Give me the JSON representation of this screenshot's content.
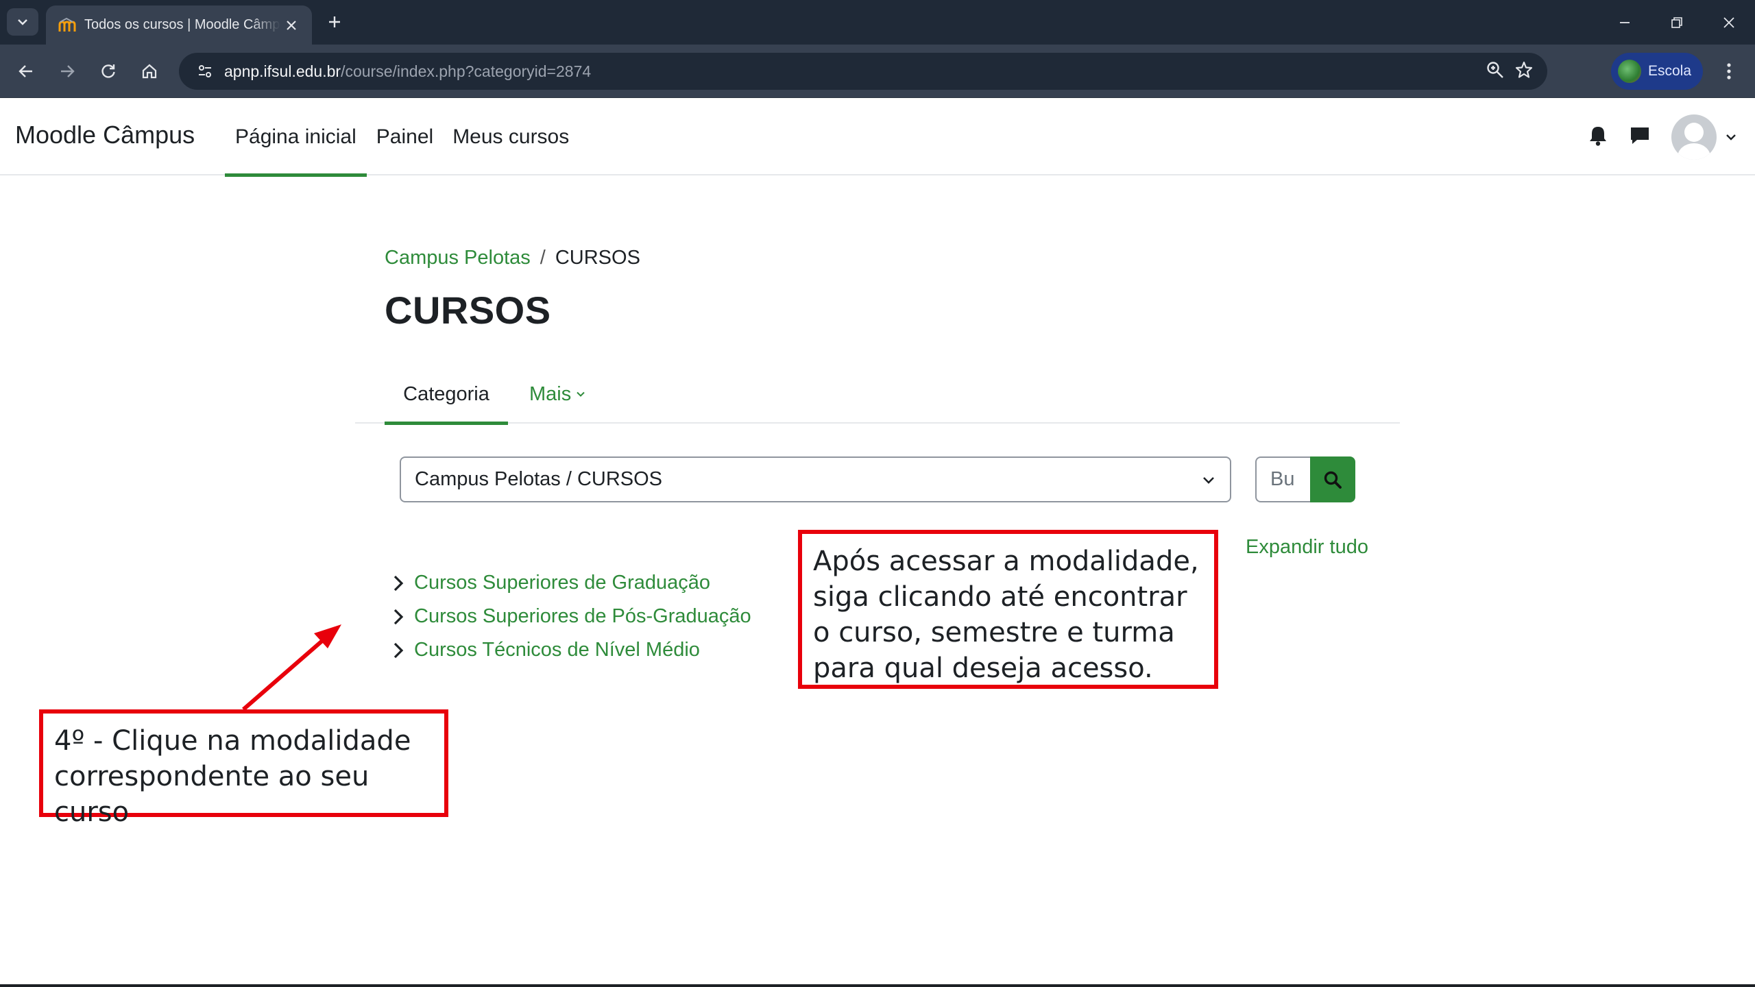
{
  "browser": {
    "tab_title": "Todos os cursos | Moodle Câmpus",
    "url_host": "apnp.ifsul.edu.br",
    "url_path": "/course/index.php?categoryid=2874",
    "profile_label": "Escola"
  },
  "navbar": {
    "brand": "Moodle Câmpus",
    "items": [
      {
        "label": "Página inicial",
        "active": true
      },
      {
        "label": "Painel",
        "active": false
      },
      {
        "label": "Meus cursos",
        "active": false
      }
    ]
  },
  "breadcrumb": {
    "parent": "Campus Pelotas",
    "separator": "/",
    "current": "CURSOS"
  },
  "page": {
    "title": "CURSOS"
  },
  "secondary_nav": {
    "active": "Categoria",
    "more": "Mais"
  },
  "category_select": {
    "value": "Campus Pelotas / CURSOS"
  },
  "search": {
    "placeholder": "Bu"
  },
  "expand_all": "Expandir tudo",
  "categories": [
    "Cursos Superiores de Graduação",
    "Cursos Superiores de Pós-Graduação",
    "Cursos Técnicos de Nível Médio"
  ],
  "annotations": {
    "step4": "4º - Clique na modalidade correspondente ao seu curso",
    "hint": "Após acessar a modalidade, siga clicando até encontrar o curso, semestre e turma para qual deseja acesso."
  },
  "colors": {
    "accent": "#2e8b3a",
    "annotation": "#e8000b",
    "chrome_dark": "#1f2937",
    "chrome_toolbar": "#374151"
  }
}
